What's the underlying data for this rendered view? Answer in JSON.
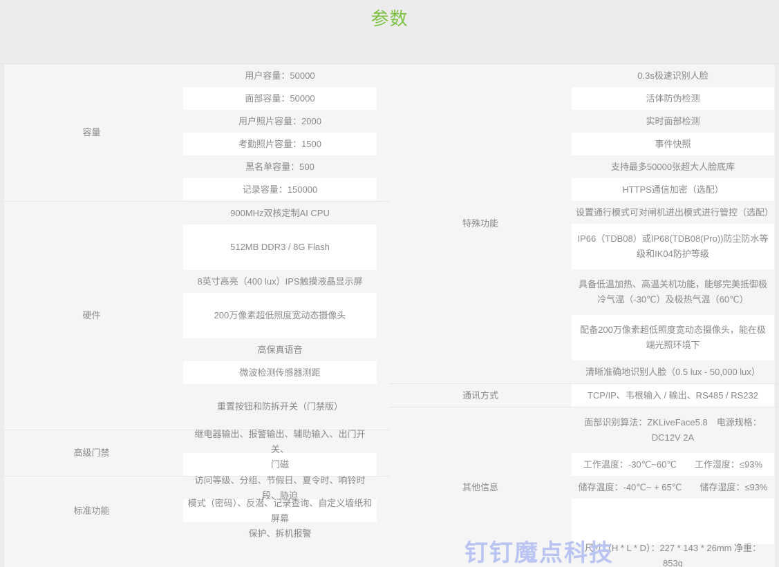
{
  "page": {
    "title": "参数",
    "title_color": "#7dc242",
    "background": "#ececec",
    "board_background": "#f5f5f5",
    "text_color": "#8a8a8a",
    "stripe_color": "#ffffff"
  },
  "watermark": {
    "text": "钉钉魔点科技",
    "color": "#b9c4f2"
  },
  "left_panel": {
    "groups": [
      {
        "label": "容量",
        "rows": [
          {
            "text": "用户容量：50000",
            "lines": 1,
            "alt": false
          },
          {
            "text": "面部容量：50000",
            "lines": 1,
            "alt": true
          },
          {
            "text": "用户照片容量：2000",
            "lines": 1,
            "alt": false
          },
          {
            "text": "考勤照片容量：1500",
            "lines": 1,
            "alt": true
          },
          {
            "text": "黑名单容量：500",
            "lines": 1,
            "alt": false
          },
          {
            "text": "记录容量：150000",
            "lines": 1,
            "alt": true
          }
        ]
      },
      {
        "label": "硬件",
        "rows": [
          {
            "text": "900MHz双核定制AI CPU",
            "lines": 1,
            "alt": false
          },
          {
            "text": "512MB DDR3 / 8G Flash",
            "lines": 2,
            "alt": true
          },
          {
            "text": "8英寸高亮（400 lux）IPS触摸液晶显示屏",
            "lines": 1,
            "alt": false
          },
          {
            "text": "200万像素超低照度宽动态摄像头",
            "lines": 2,
            "alt": true
          },
          {
            "text": "高保真语音",
            "lines": 1,
            "alt": false
          },
          {
            "text": "微波检测传感器测距",
            "lines": 1,
            "alt": true
          },
          {
            "text": "重置按钮和防拆开关（门禁版）",
            "lines": 2,
            "alt": false
          }
        ]
      },
      {
        "label": "高级门禁",
        "rows": [
          {
            "text": "继电器输出、报警输出、辅助输入、出门开关、",
            "lines": 1,
            "alt": false
          },
          {
            "text": "门磁",
            "lines": 1,
            "alt": true
          }
        ]
      },
      {
        "label": "标准功能",
        "rows": [
          {
            "text": "访问等级、分组、节假日、夏令时、响铃时段、胁迫",
            "lines": 1,
            "alt": false
          },
          {
            "text": "模式（密码）、反潜、记录查询、自定义墙纸和屏幕",
            "lines": 1,
            "alt": true
          },
          {
            "text": "保护、拆机报警",
            "lines": 1,
            "alt": false
          }
        ]
      }
    ]
  },
  "right_panel": {
    "groups": [
      {
        "label": "特殊功能",
        "rows": [
          {
            "text": "0.3s极速识别人脸",
            "lines": 1,
            "alt": false
          },
          {
            "text": "活体防伪检测",
            "lines": 1,
            "alt": true
          },
          {
            "text": "实时面部检测",
            "lines": 1,
            "alt": false
          },
          {
            "text": "事件快照",
            "lines": 1,
            "alt": true
          },
          {
            "text": "支持最多50000张超大人脸底库",
            "lines": 1,
            "alt": false
          },
          {
            "text": "HTTPS通信加密（选配）",
            "lines": 1,
            "alt": true
          },
          {
            "text": "设置通行模式可对闸机进出模式进行管控（选配）",
            "lines": 1,
            "alt": false
          },
          {
            "text": "IP66（TDB08）或IP68(TDB08(Pro))防尘防水等级和IK04防护等级",
            "lines": 2,
            "alt": true
          },
          {
            "text": "具备低温加热、高温关机功能，能够完美抵御极冷气温（-30℃）及极热气温（60℃）",
            "lines": 2,
            "alt": false
          },
          {
            "text": "配备200万像素超低照度宽动态摄像头，能在极端光照环境下",
            "lines": 2,
            "alt": true
          },
          {
            "text": "清晰准确地识别人脸（0.5 lux - 50,000 lux）",
            "lines": 1,
            "alt": false
          }
        ]
      },
      {
        "label": "通讯方式",
        "rows": [
          {
            "text": "TCP/IP、韦根输入 / 输出、RS485 / RS232",
            "lines": 1,
            "alt": true
          }
        ]
      },
      {
        "label": "其他信息",
        "rows": [
          {
            "text": "面部识别算法：ZKLiveFace5.8　电源规格：DC12V 2A",
            "lines": 2,
            "alt": false
          },
          {
            "text": "工作温度：-30℃~60℃　　工作湿度：≤93%",
            "lines": 1,
            "alt": true
          },
          {
            "text": "储存温度：-40℃~ + 65℃　　储存湿度：≤93%",
            "lines": 1,
            "alt": false
          },
          {
            "text": "",
            "lines": 2,
            "alt": true
          },
          {
            "text": "尺寸（H * L * D）：227 * 143 * 26mm  净重：853g",
            "lines": 1,
            "alt": false
          }
        ]
      }
    ]
  }
}
